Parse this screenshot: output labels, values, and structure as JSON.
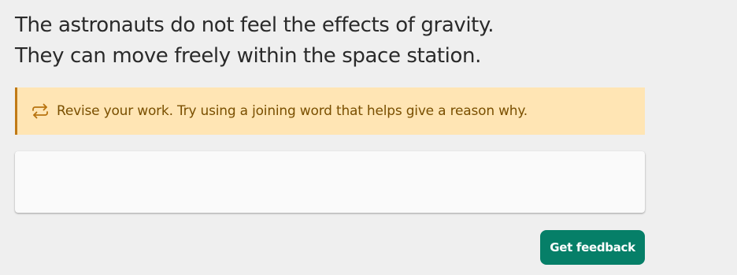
{
  "prompt": {
    "line1": "The astronauts do not feel the effects of gravity.",
    "line2": "They can move freely within the space station."
  },
  "feedback": {
    "icon": "repeat-arrows-icon",
    "message": "Revise your work. Try using a joining word that helps give a reason why.",
    "accent_color": "#c07a16",
    "background_color": "#ffe5b4"
  },
  "response": {
    "value": "",
    "placeholder": ""
  },
  "actions": {
    "submit_label": "Get feedback",
    "submit_color": "#067f68"
  }
}
